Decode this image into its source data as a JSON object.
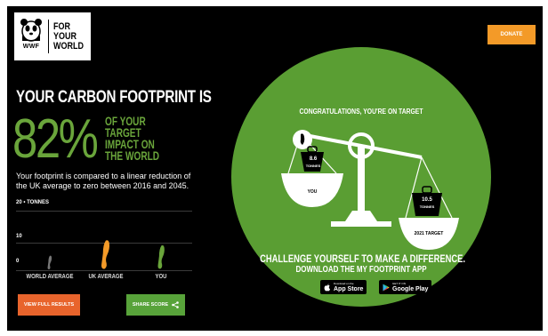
{
  "header": {
    "logo_text": "WWF",
    "tagline": [
      "FOR",
      "YOUR",
      "WORLD"
    ],
    "donate_label": "DONATE"
  },
  "result": {
    "headline": "YOUR CARBON FOOTPRINT IS",
    "percent": "82%",
    "percent_sub": [
      "OF YOUR",
      "TARGET",
      "IMPACT ON",
      "THE WORLD"
    ],
    "description": "Your footprint is compared to a linear reduction of the UK average to zero between 2016 and 2045."
  },
  "chart_data": {
    "type": "bar",
    "ylabel": "TONNES",
    "y_ticks": [
      "20 • TONNES",
      "10",
      "0"
    ],
    "ylim": [
      0,
      20
    ],
    "categories": [
      "WORLD AVERAGE",
      "UK AVERAGE",
      "YOU"
    ],
    "values": [
      5,
      10.5,
      8.6
    ],
    "colors": [
      "#777777",
      "#f39a28",
      "#6aa53b"
    ]
  },
  "buttons": {
    "view_results": "VIEW FULL RESULTS",
    "share_score": "SHARE SCORE"
  },
  "scale": {
    "congrats": "CONGRATULATIONS, YOU'RE ON TARGET",
    "you_value": "8.6",
    "you_unit": "TONNES",
    "you_label": "YOU",
    "target_value": "10.5",
    "target_unit": "TONNES",
    "target_label": "2021 TARGET"
  },
  "promo": {
    "challenge": "CHALLENGE YOURSELF TO MAKE A DIFFERENCE.",
    "download": "DOWNLOAD THE MY FOOTPRINT APP",
    "appstore_small": "Download on the",
    "appstore_big": "App Store",
    "googleplay_small": "GET IT ON",
    "googleplay_big": "Google Play"
  },
  "icons": {
    "logo": "panda-icon",
    "share": "share-icon",
    "footprint": "footprint-icon",
    "apple": "apple-icon",
    "play": "play-store-icon"
  }
}
